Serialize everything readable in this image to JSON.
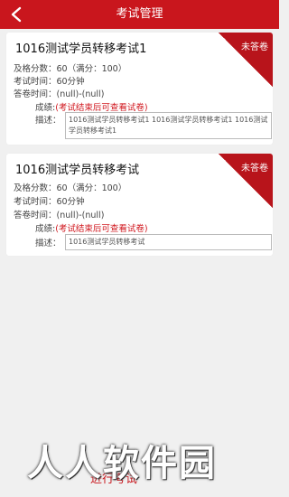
{
  "header": {
    "title": "考试管理"
  },
  "exams": [
    {
      "title": "1016测试学员转移考试1",
      "status": "未答卷",
      "pass_score": "及格分数：60（满分：100）",
      "exam_time": "考试时间：60分钟",
      "answer_time": "答卷时间：(null)-(null)",
      "score_label": "成绩:",
      "score_value": "(考试结束后可查看试卷)",
      "desc_label": "描述：",
      "desc_text": "1016测试学员转移考试1  1016测试学员转移考试1 1016测试学员转移考试1"
    },
    {
      "title": "1016测试学员转移考试",
      "status": "未答卷",
      "pass_score": "及格分数：60（满分：100）",
      "exam_time": "考试时间：60分钟",
      "answer_time": "答卷时间：(null)-(null)",
      "score_label": "成绩:",
      "score_value": "(考试结束后可查看试卷)",
      "desc_label": "描述：",
      "desc_text": "1016测试学员转移考试"
    }
  ],
  "footer": {
    "action_label": "进行考试",
    "watermark": "人人软件园"
  },
  "colors": {
    "primary": "#c9161d",
    "ribbon": "#b8141b"
  }
}
